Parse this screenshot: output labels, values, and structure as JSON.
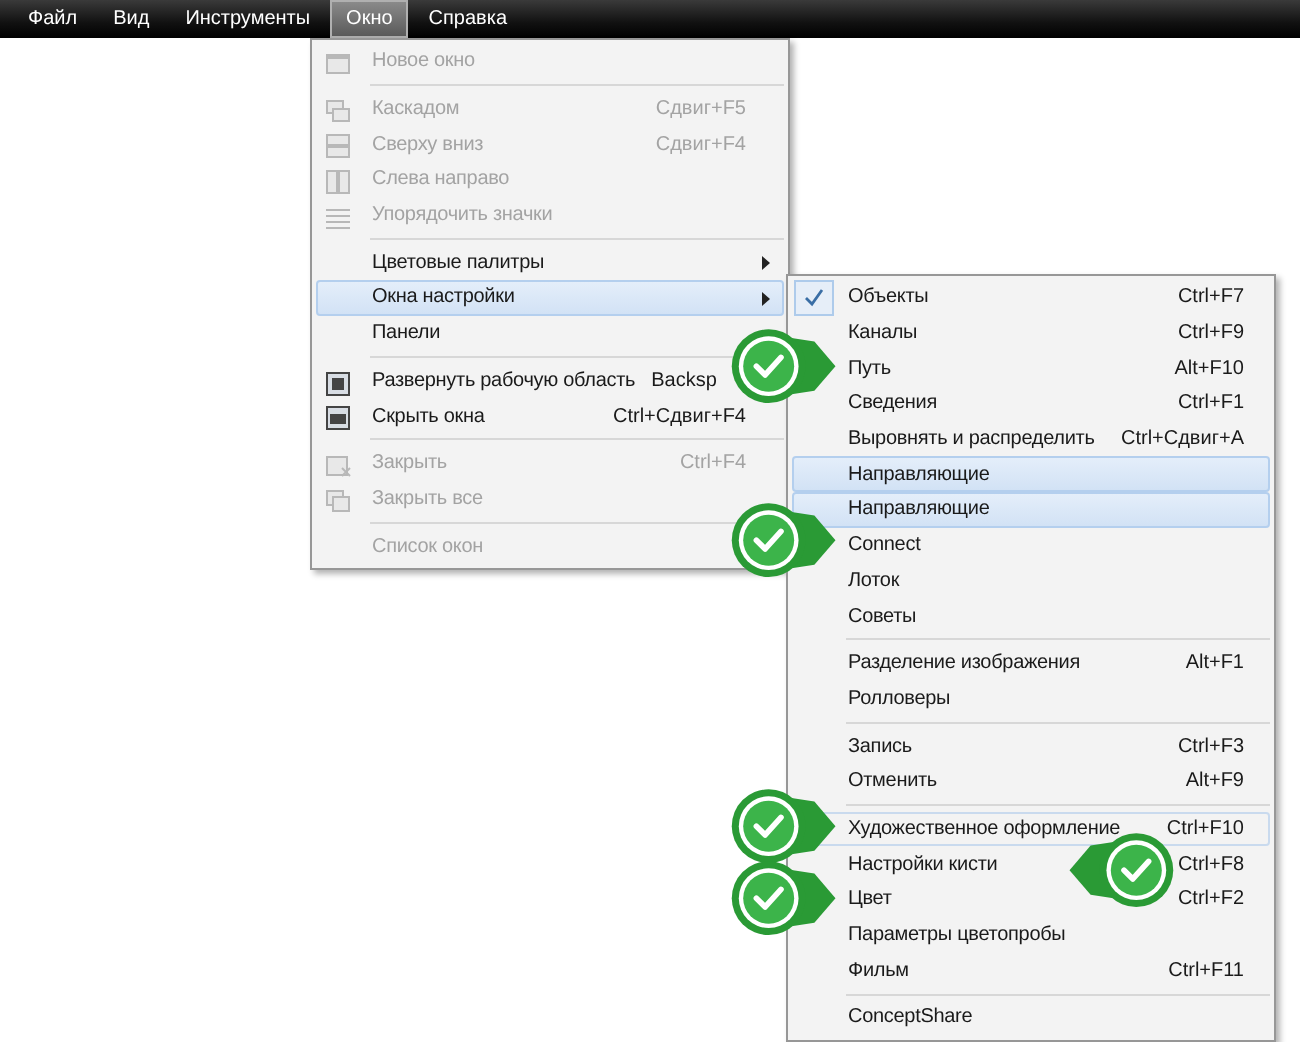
{
  "menubar": [
    {
      "label": "Файл",
      "selected": false
    },
    {
      "label": "Вид",
      "selected": false
    },
    {
      "label": "Инструменты",
      "selected": false
    },
    {
      "label": "Окно",
      "selected": true
    },
    {
      "label": "Справка",
      "selected": false
    }
  ],
  "main_menu": [
    {
      "kind": "item",
      "label": "Новое окно",
      "disabled": true,
      "selected": false
    },
    {
      "kind": "separator"
    },
    {
      "kind": "item",
      "label": "Каскадом",
      "shortcut": "Сдвиг+F5",
      "disabled": true,
      "selected": false
    },
    {
      "kind": "item",
      "label": "Сверху вниз",
      "shortcut": "Сдвиг+F4",
      "disabled": true,
      "selected": false
    },
    {
      "kind": "item",
      "label": "Слева направо",
      "disabled": true,
      "selected": false
    },
    {
      "kind": "item",
      "label": "Упорядочить значки",
      "disabled": true,
      "selected": false
    },
    {
      "kind": "separator"
    },
    {
      "kind": "item",
      "label": "Цветовые палитры",
      "submenu": true,
      "disabled": false,
      "selected": false
    },
    {
      "kind": "item",
      "label": "Окна настройки",
      "submenu": true,
      "disabled": false,
      "selected": true
    },
    {
      "kind": "item",
      "label": "Панели",
      "disabled": false,
      "selected": false
    },
    {
      "kind": "separator"
    },
    {
      "kind": "item",
      "label": "Развернуть рабочую область",
      "shortcut": "Backsp",
      "disabled": false,
      "selected": false
    },
    {
      "kind": "item",
      "label": "Скрыть окна",
      "shortcut": "Ctrl+Сдвиг+F4",
      "disabled": false,
      "selected": false
    },
    {
      "kind": "separator"
    },
    {
      "kind": "item",
      "label": "Закрыть",
      "shortcut": "Ctrl+F4",
      "disabled": true,
      "selected": false
    },
    {
      "kind": "item",
      "label": "Закрыть все",
      "disabled": true,
      "selected": false
    },
    {
      "kind": "separator"
    },
    {
      "kind": "item",
      "label": "Список окон",
      "disabled": true,
      "selected": false
    }
  ],
  "submenu": [
    {
      "kind": "item",
      "label": "Объекты",
      "shortcut": "Ctrl+F7",
      "checked": true,
      "selected": false,
      "outlined": false
    },
    {
      "kind": "item",
      "label": "Каналы",
      "shortcut": "Ctrl+F9",
      "checked": false,
      "selected": false,
      "outlined": false
    },
    {
      "kind": "item",
      "label": "Путь",
      "shortcut": "Alt+F10",
      "checked": false,
      "selected": false,
      "outlined": false
    },
    {
      "kind": "item",
      "label": "Сведения",
      "shortcut": "Ctrl+F1",
      "checked": false,
      "selected": false,
      "outlined": false
    },
    {
      "kind": "item",
      "label": "Выровнять и распределить",
      "shortcut": "Ctrl+Сдвиг+A",
      "checked": false,
      "selected": false,
      "outlined": false
    },
    {
      "kind": "item",
      "label": "Направляющие",
      "checked": false,
      "selected": true,
      "outlined": false
    },
    {
      "kind": "item",
      "label": "Направляющие",
      "checked": false,
      "selected": true,
      "outlined": false
    },
    {
      "kind": "item",
      "label": "Connect",
      "checked": false,
      "selected": false,
      "outlined": false
    },
    {
      "kind": "item",
      "label": "Лоток",
      "checked": false,
      "selected": false,
      "outlined": false
    },
    {
      "kind": "item",
      "label": "Советы",
      "checked": false,
      "selected": false,
      "outlined": false
    },
    {
      "kind": "separator"
    },
    {
      "kind": "item",
      "label": "Разделение изображения",
      "shortcut": "Alt+F1",
      "checked": false,
      "selected": false,
      "outlined": false
    },
    {
      "kind": "item",
      "label": "Ролловеры",
      "checked": false,
      "selected": false,
      "outlined": false
    },
    {
      "kind": "separator"
    },
    {
      "kind": "item",
      "label": "Запись",
      "shortcut": "Ctrl+F3",
      "checked": false,
      "selected": false,
      "outlined": false
    },
    {
      "kind": "item",
      "label": "Отменить",
      "shortcut": "Alt+F9",
      "checked": false,
      "selected": false,
      "outlined": false
    },
    {
      "kind": "separator"
    },
    {
      "kind": "item",
      "label": "Художественное оформление",
      "shortcut": "Ctrl+F10",
      "checked": false,
      "selected": false,
      "outlined": true
    },
    {
      "kind": "item",
      "label": "Настройки кисти",
      "shortcut": "Ctrl+F8",
      "checked": false,
      "selected": false,
      "outlined": false
    },
    {
      "kind": "item",
      "label": "Цвет",
      "shortcut": "Ctrl+F2",
      "checked": false,
      "selected": false,
      "outlined": false
    },
    {
      "kind": "item",
      "label": "Параметры цветопробы",
      "checked": false,
      "selected": false,
      "outlined": false
    },
    {
      "kind": "item",
      "label": "Фильм",
      "shortcut": "Ctrl+F11",
      "checked": false,
      "selected": false,
      "outlined": false
    },
    {
      "kind": "separator"
    },
    {
      "kind": "item",
      "label": "ConceptShare",
      "checked": false,
      "selected": false,
      "outlined": false
    }
  ],
  "callouts": [
    {
      "kind": "right"
    },
    {
      "kind": "right"
    },
    {
      "kind": "right"
    },
    {
      "kind": "left"
    },
    {
      "kind": "right"
    }
  ]
}
